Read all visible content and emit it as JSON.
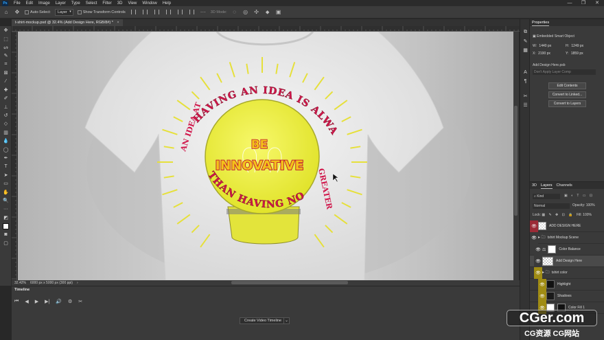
{
  "menubar": {
    "logo": "Ps",
    "items": [
      "File",
      "Edit",
      "Image",
      "Layer",
      "Type",
      "Select",
      "Filter",
      "3D",
      "View",
      "Window",
      "Help"
    ],
    "window_controls": [
      "—",
      "❐",
      "✕"
    ]
  },
  "options": {
    "auto_select_label": "Auto-Select:",
    "auto_select_value": "Layer",
    "show_transform_label": "Show Transform Controls",
    "mode_3d_label": "3D Mode:"
  },
  "document": {
    "tab_title": "t-shirt-mockup.psd @ 32.4% (Add Design Here, RGB/8#) *",
    "tab_close": "×",
    "zoom": "32.42%",
    "doc_info": "6000 px x 5000 px (300 ppi)",
    "status_arrow": "›"
  },
  "design": {
    "arc_top": "HAVING AN IDEA IS ALWAYS",
    "arc_left": "AN IDEA AT",
    "arc_bottom_left": "THAN HAVING NO",
    "arc_right": "GREATER",
    "center_line1": "BE",
    "center_line2": "INNOVATIVE",
    "colors": {
      "bulb": "#eef03a",
      "text_red": "#d0164a",
      "text_gold": "#f3c21a",
      "base": "#e3e43b"
    }
  },
  "timeline": {
    "title": "Timeline",
    "controls": [
      "⏮",
      "◀",
      "▶",
      "▶|",
      "🔊",
      "⚙",
      "✂"
    ],
    "create_button": "Create Video Timeline",
    "dropdown": "⌄"
  },
  "properties": {
    "title": "Properties",
    "layer_type": "Embedded Smart Object",
    "w_label": "W:",
    "w_value": "1440 px",
    "h_label": "H:",
    "h_value": "1249 px",
    "x_label": "X:",
    "x_value": "2190 px",
    "y_label": "Y:",
    "y_value": "1859 px",
    "source_file": "Add Design Here.psb",
    "layer_comp": "Don't Apply Layer Comp",
    "btn_edit": "Edit Contents",
    "btn_linked": "Convert to Linked...",
    "btn_layers": "Convert to Layers"
  },
  "layers_panel": {
    "tabs": [
      "3D",
      "Layers",
      "Channels"
    ],
    "kind_label": "Kind",
    "blend_mode": "Normal",
    "opacity_label": "Opacity:",
    "opacity_value": "100%",
    "lock_label": "Lock:",
    "fill_label": "Fill:",
    "fill_value": "100%",
    "rows": [
      {
        "name": "ADD DESIGN HERE",
        "eye_color": "#9b2b36"
      },
      {
        "name": "tshirt Mockup Scene",
        "eye_color": "#3a3a3a"
      },
      {
        "name": "Color Balance",
        "eye_color": "#3a3a3a"
      },
      {
        "name": "Add Design Here",
        "eye_color": "#3a3a3a"
      },
      {
        "name": "tshirt color",
        "eye_color": "#a08c14"
      },
      {
        "name": "Highlight",
        "eye_color": "#a08c14"
      },
      {
        "name": "Shadows",
        "eye_color": "#a08c14"
      },
      {
        "name": "Color Fill 1",
        "eye_color": "#a08c14"
      }
    ]
  },
  "watermark": {
    "main": "CGer.com",
    "sub": "CG资源 CG网站"
  }
}
